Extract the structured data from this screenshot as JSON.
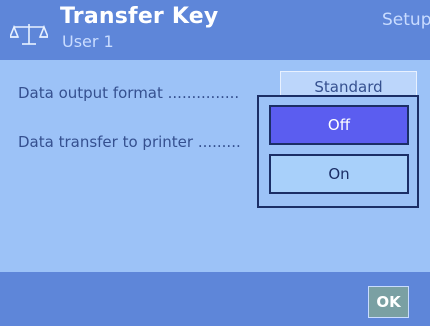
{
  "header": {
    "title": "Transfer Key",
    "subtitle": "User 1",
    "section": "Setup",
    "icon": "balance-scale-icon"
  },
  "settings": [
    {
      "label": "Data output format ...............",
      "value": "Standard"
    },
    {
      "label": "Data transfer to printer ........."
    }
  ],
  "popup": {
    "options": [
      "Off",
      "On"
    ],
    "selected": "Off"
  },
  "footer": {
    "ok_label": "OK"
  },
  "colors": {
    "header_bg": "#5e86d9",
    "body_bg": "#9cc2f7",
    "selected_option": "#5b5df0",
    "option_bg": "#a8d0fa",
    "ok_button": "#7aa0a3"
  }
}
